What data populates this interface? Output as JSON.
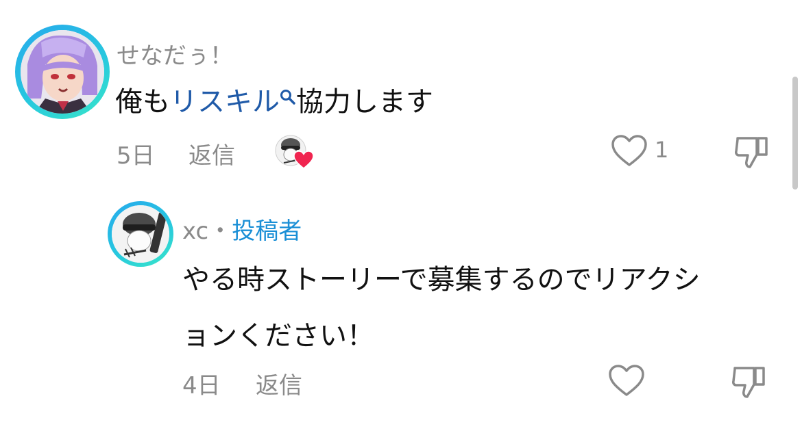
{
  "comments": [
    {
      "author": "せなだぅ！",
      "text_prefix": "俺も",
      "link_text": "リスキル",
      "text_suffix": "協力します",
      "age": "5日",
      "reply_label": "返信",
      "like_count": "1",
      "icons": {
        "like": "heart-outline-icon",
        "dislike": "thumbs-down-icon",
        "search": "search-icon",
        "creator_heart": "red-heart-icon"
      }
    },
    {
      "author": "xc",
      "separator": "・",
      "author_badge": "投稿者",
      "text_line1": "やる時ストーリーで募集するのでリアクシ",
      "text_line2": "ョンください！",
      "age": "4日",
      "reply_label": "返信",
      "icons": {
        "like": "heart-outline-icon",
        "dislike": "thumbs-down-icon"
      }
    }
  ],
  "colors": {
    "link": "#1f5aa8",
    "author_badge": "#1a8fd6",
    "meta_text": "#8a8a8a",
    "heart_badge": "#f0244f",
    "avatar_ring_start": "#27a9ec",
    "avatar_ring_end": "#39e6c8"
  }
}
